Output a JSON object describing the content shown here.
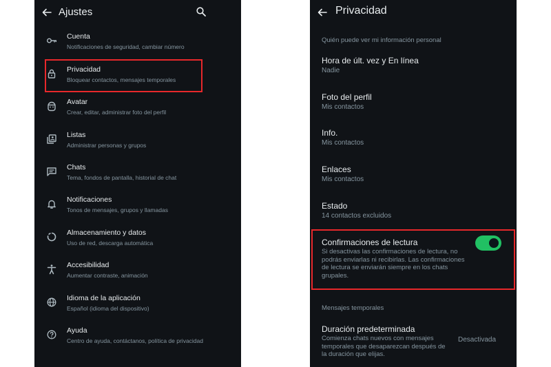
{
  "settings": {
    "title": "Ajustes",
    "items": [
      {
        "label": "Cuenta",
        "sub": "Notificaciones de seguridad, cambiar número",
        "icon": "key-icon"
      },
      {
        "label": "Privacidad",
        "sub": "Bloquear contactos, mensajes temporales",
        "icon": "lock-icon"
      },
      {
        "label": "Avatar",
        "sub": "Crear, editar, administrar foto del perfil",
        "icon": "avatar-face-icon"
      },
      {
        "label": "Listas",
        "sub": "Administrar personas y grupos",
        "icon": "lists-icon"
      },
      {
        "label": "Chats",
        "sub": "Tema, fondos de pantalla, historial de chat",
        "icon": "chat-icon"
      },
      {
        "label": "Notificaciones",
        "sub": "Tonos de mensajes, grupos y llamadas",
        "icon": "bell-icon"
      },
      {
        "label": "Almacenamiento y datos",
        "sub": "Uso de red, descarga automática",
        "icon": "storage-circle-icon"
      },
      {
        "label": "Accesibilidad",
        "sub": "Aumentar contraste, animación",
        "icon": "accessibility-icon"
      },
      {
        "label": "Idioma de la aplicación",
        "sub": "Español (idioma del dispositivo)",
        "icon": "globe-icon"
      },
      {
        "label": "Ayuda",
        "sub": "Centro de ayuda, contáctanos, política de privacidad",
        "icon": "help-icon"
      }
    ]
  },
  "privacy": {
    "title": "Privacidad",
    "section_personal": "Quién puede ver mi información personal",
    "items": [
      {
        "label": "Hora de últ. vez y En línea",
        "value": "Nadie"
      },
      {
        "label": "Foto del perfil",
        "value": "Mis contactos"
      },
      {
        "label": "Info.",
        "value": "Mis contactos"
      },
      {
        "label": "Enlaces",
        "value": "Mis contactos"
      },
      {
        "label": "Estado",
        "value": "14 contactos excluidos"
      }
    ],
    "read_receipts": {
      "label": "Confirmaciones de lectura",
      "description": "Si desactivas las confirmaciones de lectura, no podrás enviarlas ni recibirlas. Las confirmaciones de lectura se enviarán siempre en los chats grupales.",
      "enabled": true
    },
    "section_temporary": "Mensajes temporales",
    "default_duration": {
      "label": "Duración predeterminada",
      "description": "Comienza chats nuevos con mensajes temporales que desaparezcan después de la duración que elijas.",
      "value": "Desactivada"
    }
  },
  "colors": {
    "background": "#101317",
    "text": "#e9edef",
    "secondary": "#8696a0",
    "accent": "#21c063",
    "highlight": "#e8282b"
  }
}
